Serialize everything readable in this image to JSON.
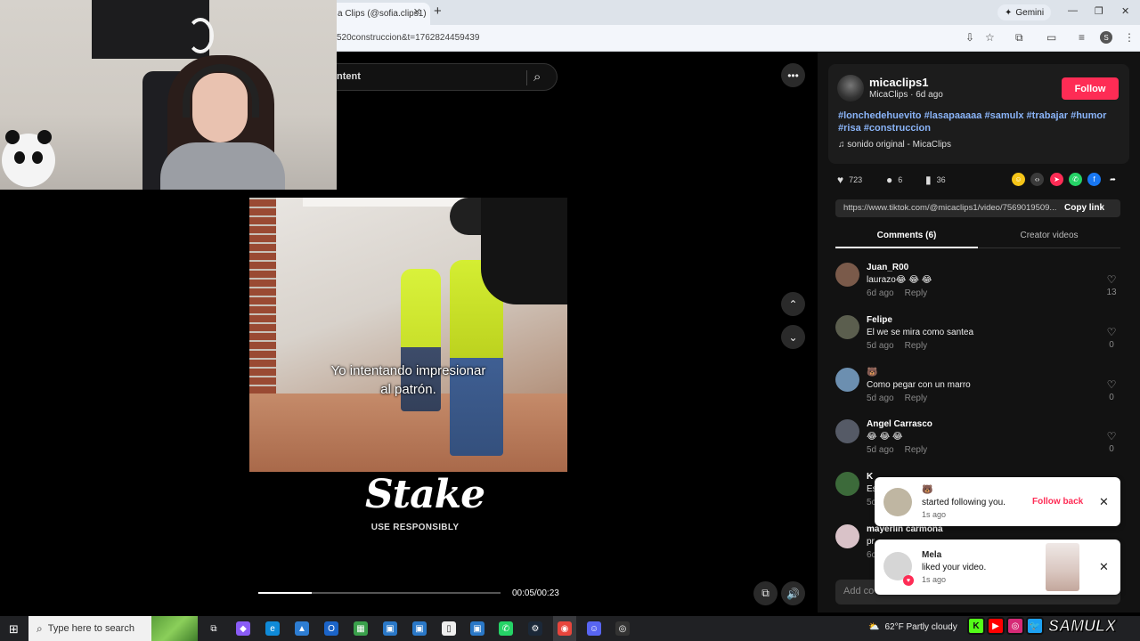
{
  "browser": {
    "tab_title": "a Clips (@sofia.clips1)",
    "tab_close": "✕",
    "new_tab": "+",
    "gemini_label": "Gemini",
    "url": "520construccion&t=1762824459439",
    "profile_initial": "S",
    "window_controls": [
      "—",
      "❐",
      "✕"
    ]
  },
  "search": {
    "text": "ntent",
    "icon": "search-icon"
  },
  "video": {
    "subtitle_line1": "Yo intentando impresionar",
    "subtitle_line2": "al patrón.",
    "sponsor_logo": "Stake",
    "sponsor_tagline": "USE RESPONSIBLY",
    "time": "00:05/00:23",
    "progress": 0.22
  },
  "post": {
    "username": "micaclips1",
    "meta": "MicaClips · 6d ago",
    "follow_label": "Follow",
    "hashtags": "#lonchedehuevito #lasapaaaaa #samulx #trabajar #humor #risa #construccion",
    "sound": "sonido original - MicaClips",
    "likes": "723",
    "comments": "6",
    "saves": "36",
    "link": "https://www.tiktok.com/@micaclips1/video/7569019509...",
    "copy_link_label": "Copy link",
    "tab_comments": "Comments (6)",
    "tab_creator": "Creator videos"
  },
  "comments": [
    {
      "name": "Juan_R00",
      "text": "laurazo😂 😂 😂",
      "time": "6d ago",
      "reply": "Reply",
      "likes": "13"
    },
    {
      "name": "Felipe",
      "text": "El we se mira como santea",
      "time": "5d ago",
      "reply": "Reply",
      "likes": "0"
    },
    {
      "name": "🐻",
      "text": "Como pegar con un marro",
      "time": "5d ago",
      "reply": "Reply",
      "likes": "0"
    },
    {
      "name": "Angel Carrasco",
      "text": "😂 😂 😂",
      "time": "5d ago",
      "reply": "Reply",
      "likes": "0"
    },
    {
      "name": "K",
      "text": "Es",
      "time": "5c",
      "reply": "",
      "likes": ""
    },
    {
      "name": "mayerlin carmona",
      "text": "pr",
      "time": "6c",
      "reply": "",
      "likes": ""
    }
  ],
  "comment_input_placeholder": "Add co",
  "notifications": [
    {
      "name": "🐻",
      "text": "started following you.",
      "time": "1s ago",
      "action": "Follow back"
    },
    {
      "name": "Mela",
      "text": "liked your video.",
      "time": "1s ago",
      "action": ""
    }
  ],
  "taskbar": {
    "search_placeholder": "Type here to search",
    "weather": "62°F  Partly cloudy"
  },
  "overlay": {
    "channel_name": "SAMULX",
    "icons": [
      "K",
      "▶",
      "◎",
      "🐦"
    ]
  },
  "colors": {
    "accent": "#fe2c55",
    "hashtag": "#8ab4f8",
    "panel_bg": "#121212"
  }
}
